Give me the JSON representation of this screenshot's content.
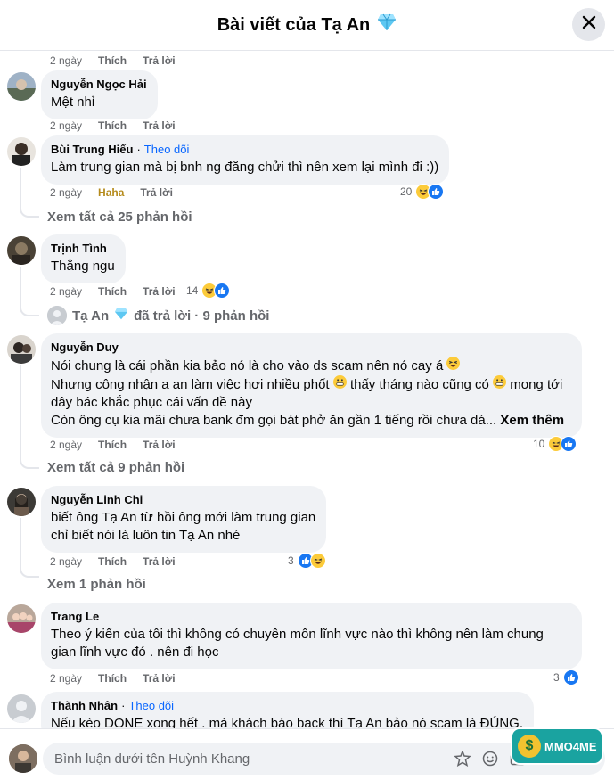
{
  "header": {
    "title": "Bài viết của Tạ An"
  },
  "labels": {
    "like": "Thích",
    "reply": "Trả lời",
    "haha": "Haha",
    "follow": "Theo dõi",
    "see_more": "Xem thêm",
    "dot": "·"
  },
  "top_actions": {
    "time": "2 ngày"
  },
  "comments": [
    {
      "name": "Nguyễn Ngọc Hải",
      "lines": [
        "Mệt nhỉ"
      ],
      "time": "2 ngày"
    },
    {
      "name": "Bùi Trung Hiếu",
      "lines": [
        "Làm trung gian mà bị bnh ng đăng chửi thì nên xem lại mình đi :))"
      ],
      "time": "2 ngày",
      "reaction_count": "20",
      "view_replies": "Xem tất cả 25 phản hồi"
    },
    {
      "name": "Trịnh Tình",
      "lines": [
        "Thằng ngu"
      ],
      "time": "2 ngày",
      "reaction_count": "14",
      "reply_preview": {
        "author": "Tạ An",
        "text": "đã trả lời · 9 phản hồi"
      }
    },
    {
      "name": "Nguyễn Duy",
      "lines": [
        "Nói chung là cái phần kia bảo nó là cho vào ds scam nên nó cay á",
        "Nhưng công nhận a an làm việc hơi nhiều phốt",
        "thấy tháng nào cũng có",
        "mong tới",
        "đây bác khắc phục cái vấn đề này",
        "Còn ông cụ kia mãi chưa bank đm gọi bát phở ăn gần 1 tiếng rồi chưa dá..."
      ],
      "time": "2 ngày",
      "reaction_count": "10",
      "view_replies": "Xem tất cả 9 phản hồi"
    },
    {
      "name": "Nguyễn Linh Chi",
      "lines": [
        "biết ông Tạ An từ hồi ông mới làm trung gian",
        "chỉ biết nói là luôn tin Tạ An nhé"
      ],
      "time": "2 ngày",
      "reaction_count": "3",
      "view_replies": "Xem 1 phản hồi"
    },
    {
      "name": "Trang Le",
      "lines": [
        "Theo ý kiến của tôi thì không có chuyên môn lĩnh vực nào thì không nên làm chung",
        "gian lĩnh vực đó . nên đi học"
      ],
      "time": "2 ngày",
      "reaction_count": "3"
    },
    {
      "name": "Thành Nhân",
      "lines": [
        "Nếu kèo DONE xong hết . mà khách báo back thì Tạ An bảo nó scam là ĐÚNG."
      ]
    }
  ],
  "composer": {
    "placeholder": "Bình luận dưới tên Huỳnh Khang"
  },
  "watermark": {
    "text": "MMO4ME",
    "coin": "$"
  },
  "colors": {
    "link": "#0866ff",
    "haha": "#b58b1c",
    "like": "#1877f2",
    "bubble": "#f0f2f5"
  }
}
